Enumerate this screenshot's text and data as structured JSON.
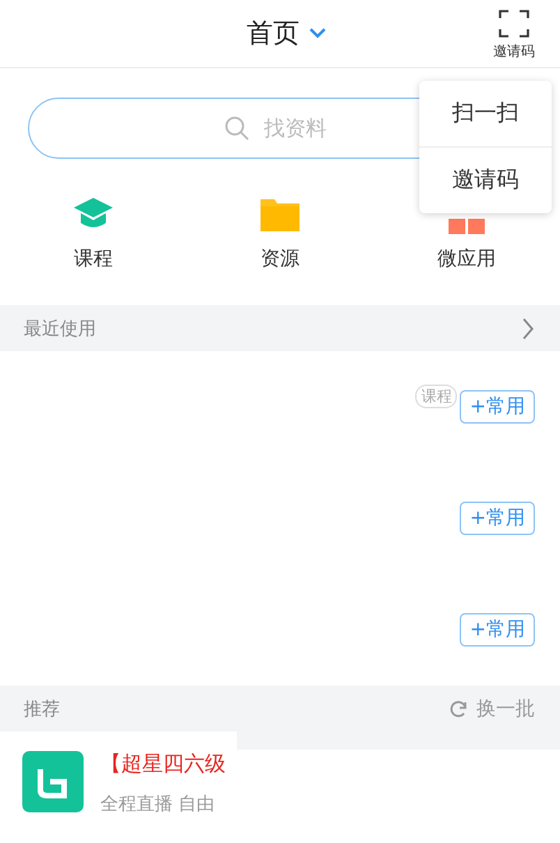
{
  "header": {
    "title": "首页",
    "scan_label": "邀请码"
  },
  "menu": {
    "items": [
      "扫一扫",
      "邀请码"
    ]
  },
  "search": {
    "placeholder": "找资料"
  },
  "shortcuts": [
    {
      "kind": "course",
      "label": "课程"
    },
    {
      "kind": "resource",
      "label": "资源"
    },
    {
      "kind": "apps",
      "label": "微应用"
    }
  ],
  "recent": {
    "title": "最近使用",
    "items": [
      {
        "tag": "课程",
        "button": "+常用"
      },
      {
        "button": "+常用"
      },
      {
        "button": "+常用"
      }
    ]
  },
  "recommend": {
    "title": "推荐",
    "refresh": "换一批",
    "items": [
      {
        "title": "【超星四六级",
        "subtitle": "全程直播  自由"
      }
    ]
  }
}
